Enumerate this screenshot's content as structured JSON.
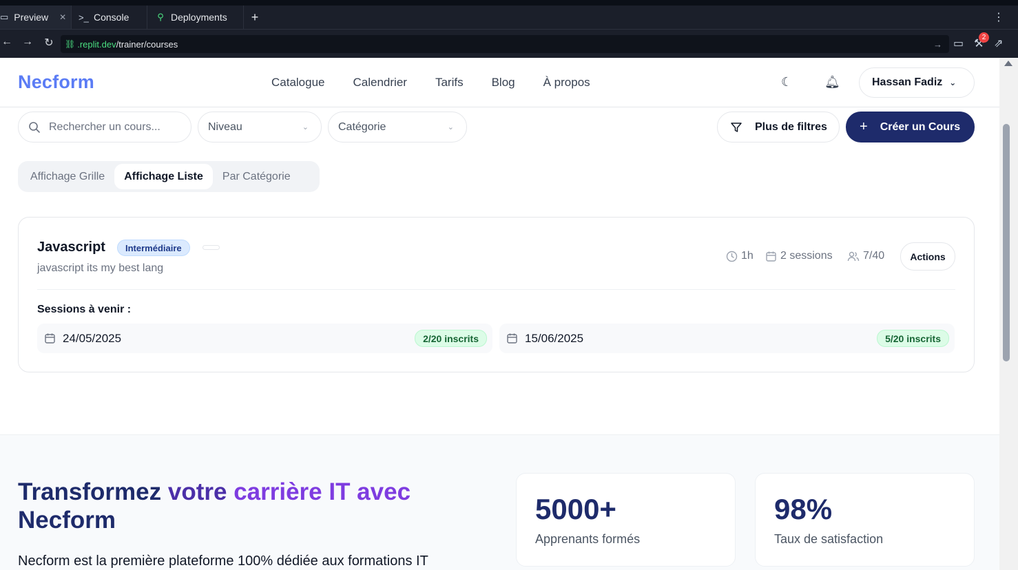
{
  "browser": {
    "tabs": [
      {
        "label": "Preview",
        "icon": "monitor-icon"
      },
      {
        "label": "Console",
        "icon": "terminal-icon"
      },
      {
        "label": "Deployments",
        "icon": "deploy-icon"
      }
    ],
    "url_domain": ".replit.dev",
    "url_path": "/trainer/courses",
    "badge_count": "2"
  },
  "header": {
    "logo": "Necform",
    "nav": [
      "Catalogue",
      "Calendrier",
      "Tarifs",
      "Blog",
      "À propos"
    ],
    "user": "Hassan Fadiz"
  },
  "filters": {
    "search_placeholder": "Rechercher un cours...",
    "level": "Niveau",
    "category": "Catégorie",
    "more_filters": "Plus de filtres",
    "create": "Créer un Cours"
  },
  "views": [
    "Affichage Grille",
    "Affichage Liste",
    "Par Catégorie"
  ],
  "active_view": "Affichage Liste",
  "course": {
    "title": "Javascript",
    "level": "Intermédiaire",
    "description": "javascript its my best lang",
    "duration": "1h",
    "sessions_count": "2 sessions",
    "enrolled": "7/40",
    "actions": "Actions",
    "sessions_label": "Sessions à venir :",
    "sessions": [
      {
        "date": "24/05/2025",
        "count": "2/20 inscrits"
      },
      {
        "date": "15/06/2025",
        "count": "5/20 inscrits"
      }
    ]
  },
  "promo": {
    "title_part1": "Transformez",
    "title_part2": "votre",
    "title_part3": "carrière IT avec",
    "title_part4": "Necform",
    "text": "Necform est la première plateforme 100% dédiée aux formations IT",
    "stats": [
      {
        "value": "5000+",
        "label": "Apprenants formés"
      },
      {
        "value": "98%",
        "label": "Taux de satisfaction"
      }
    ]
  },
  "colors": {
    "brand": "#5b7cf5",
    "primary_button": "#1e2b6b",
    "success_badge": "#dcfce7"
  }
}
